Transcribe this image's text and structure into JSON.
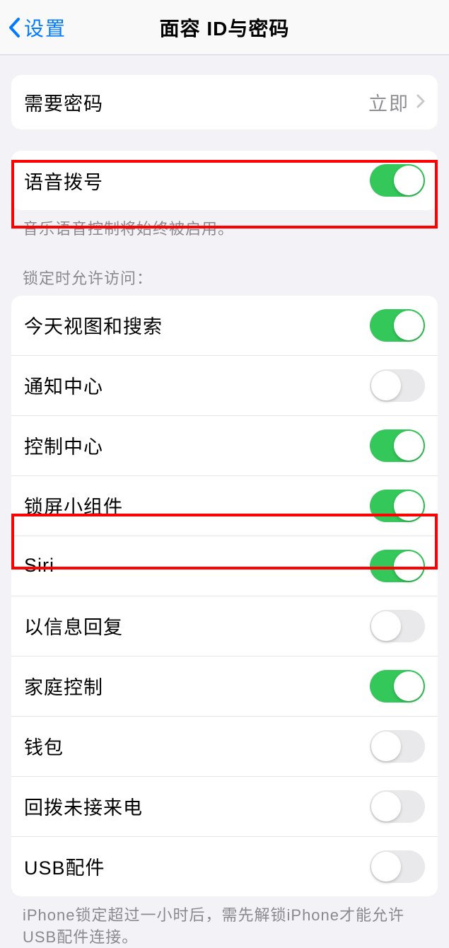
{
  "nav": {
    "back_label": "设置",
    "title": "面容 ID与密码"
  },
  "passcode_group": {
    "require_passcode_label": "需要密码",
    "require_passcode_value": "立即"
  },
  "voice_dial": {
    "label": "语音拨号",
    "enabled": true,
    "footer": "音乐语音控制将始终被启用。"
  },
  "allow_access_header": "锁定时允许访问：",
  "allow_access_items": [
    {
      "label": "今天视图和搜索",
      "enabled": true
    },
    {
      "label": "通知中心",
      "enabled": false
    },
    {
      "label": "控制中心",
      "enabled": true
    },
    {
      "label": "锁屏小组件",
      "enabled": true
    },
    {
      "label": "Siri",
      "enabled": true
    },
    {
      "label": "以信息回复",
      "enabled": false
    },
    {
      "label": "家庭控制",
      "enabled": true
    },
    {
      "label": "钱包",
      "enabled": false
    },
    {
      "label": "回拨未接来电",
      "enabled": false
    },
    {
      "label": "USB配件",
      "enabled": false
    }
  ],
  "allow_access_footer": "iPhone锁定超过一小时后，需先解锁iPhone才能允许USB配件连接。"
}
